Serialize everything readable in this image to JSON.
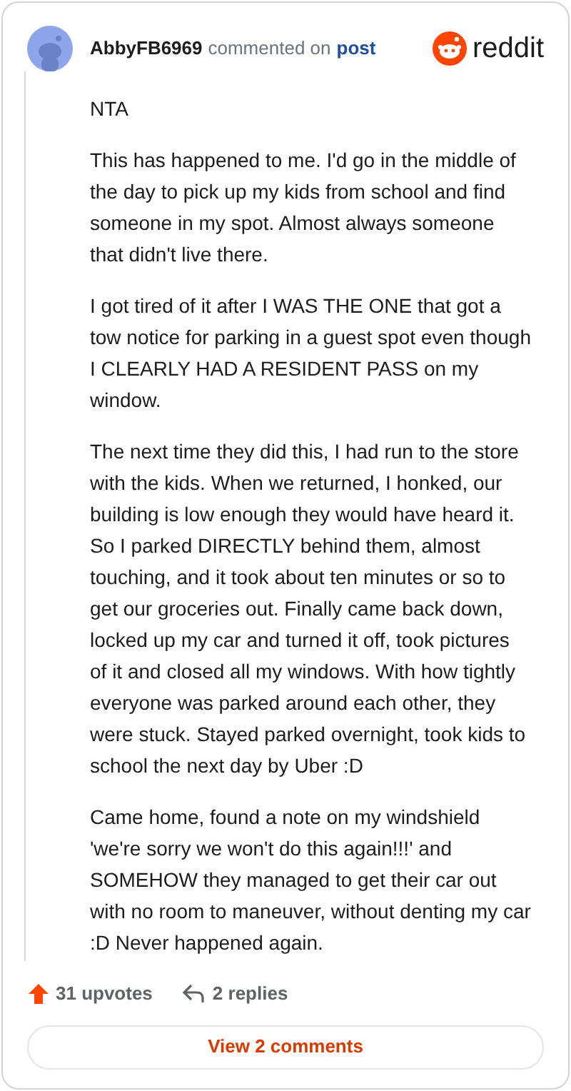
{
  "comment": {
    "author": "AbbyFB6969",
    "action": "commented on",
    "target": "post"
  },
  "brand": {
    "name": "reddit"
  },
  "paragraphs": [
    "NTA",
    "This has happened to me. I'd go in the middle of the day to pick up my kids from school and find someone in my spot. Almost always someone that didn't live there.",
    "I got tired of it after I WAS THE ONE that got a tow notice for parking in a guest spot even though I CLEARLY HAD A RESIDENT PASS on my window.",
    "The next time they did this, I had run to the store with the kids. When we returned, I honked, our building is low enough they would have heard it. So I parked DIRECTLY behind them, almost touching, and it took about ten minutes or so to get our groceries out. Finally came back down, locked up my car and turned it off, took pictures of it and closed all my windows. With how tightly everyone was parked around each other, they were stuck. Stayed parked overnight, took kids to school the next day by Uber :D",
    "Came home, found a note on my windshield 'we're sorry we won't do this again!!!' and SOMEHOW they managed to get their car out with no room to maneuver, without denting my car :D Never happened again."
  ],
  "stats": {
    "upvotes": "31 upvotes",
    "replies": "2 replies"
  },
  "view_button": "View 2 comments"
}
